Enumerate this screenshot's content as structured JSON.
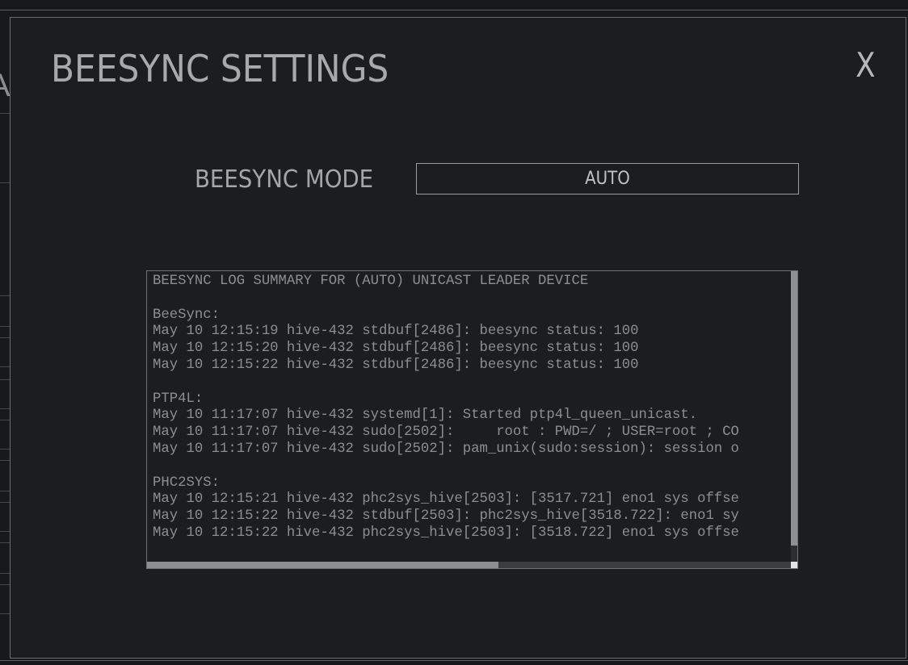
{
  "modal": {
    "title": "BEESYNC SETTINGS",
    "close_label": "X"
  },
  "background": {
    "partial_letter": "A"
  },
  "mode": {
    "label": "BEESYNC MODE",
    "value": "AUTO"
  },
  "log": {
    "lines": [
      "BEESYNC LOG SUMMARY FOR (AUTO) UNICAST LEADER DEVICE",
      "",
      "BeeSync:",
      "May 10 12:15:19 hive-432 stdbuf[2486]: beesync status: 100",
      "May 10 12:15:20 hive-432 stdbuf[2486]: beesync status: 100",
      "May 10 12:15:22 hive-432 stdbuf[2486]: beesync status: 100",
      "",
      "PTP4L:",
      "May 10 11:17:07 hive-432 systemd[1]: Started ptp4l_queen_unicast.",
      "May 10 11:17:07 hive-432 sudo[2502]:     root : PWD=/ ; USER=root ; CO",
      "May 10 11:17:07 hive-432 sudo[2502]: pam_unix(sudo:session): session o",
      "",
      "PHC2SYS:",
      "May 10 12:15:21 hive-432 phc2sys_hive[2503]: [3517.721] eno1 sys offse",
      "May 10 12:15:22 hive-432 stdbuf[2503]: phc2sys_hive[3518.722]: eno1 sy",
      "May 10 12:15:22 hive-432 phc2sys_hive[2503]: [3518.722] eno1 sys offse"
    ]
  }
}
